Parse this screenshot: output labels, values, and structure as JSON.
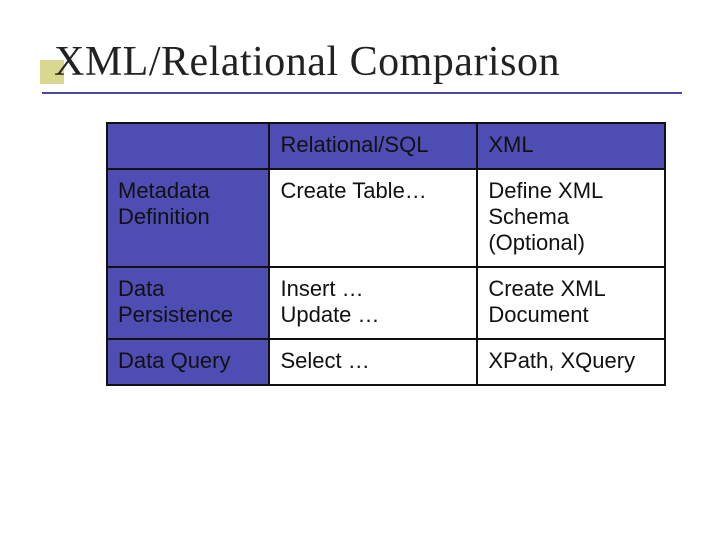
{
  "title": "XML/Relational Comparison",
  "chart_data": {
    "type": "table",
    "columns": [
      "",
      "Relational/SQL",
      "XML"
    ],
    "rows": [
      {
        "label": "Metadata Definition",
        "relational": "Create Table…",
        "xml": "Define XML Schema (Optional)"
      },
      {
        "label": "Data Persistence",
        "relational": "Insert … Update …",
        "xml": "Create XML Document"
      },
      {
        "label": "Data Query",
        "relational": "Select …",
        "xml": "XPath, XQuery"
      }
    ]
  },
  "table": {
    "col_rel": "Relational/SQL",
    "col_xml": "XML",
    "r0_label": "Metadata Definition",
    "r0_rel": "Create Table…",
    "r0_xml": "Define XML Schema (Optional)",
    "r1_label": "Data Persistence",
    "r1_rel_l1": "Insert …",
    "r1_rel_l2": "Update …",
    "r1_xml": "Create XML Document",
    "r2_label": "Data Query",
    "r2_rel": "Select …",
    "r2_xml": "XPath, XQuery"
  }
}
